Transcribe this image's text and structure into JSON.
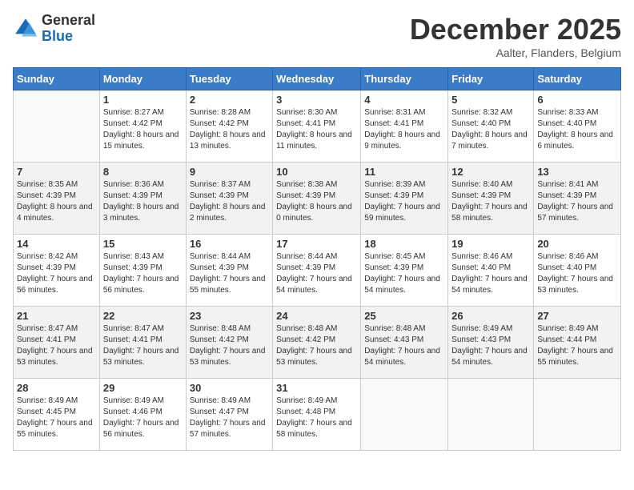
{
  "header": {
    "logo": {
      "general": "General",
      "blue": "Blue"
    },
    "title": "December 2025",
    "subtitle": "Aalter, Flanders, Belgium"
  },
  "weekdays": [
    "Sunday",
    "Monday",
    "Tuesday",
    "Wednesday",
    "Thursday",
    "Friday",
    "Saturday"
  ],
  "weeks": [
    [
      {
        "day": "",
        "empty": true
      },
      {
        "day": "1",
        "sunrise": "8:27 AM",
        "sunset": "4:42 PM",
        "daylight": "8 hours and 15 minutes."
      },
      {
        "day": "2",
        "sunrise": "8:28 AM",
        "sunset": "4:42 PM",
        "daylight": "8 hours and 13 minutes."
      },
      {
        "day": "3",
        "sunrise": "8:30 AM",
        "sunset": "4:41 PM",
        "daylight": "8 hours and 11 minutes."
      },
      {
        "day": "4",
        "sunrise": "8:31 AM",
        "sunset": "4:41 PM",
        "daylight": "8 hours and 9 minutes."
      },
      {
        "day": "5",
        "sunrise": "8:32 AM",
        "sunset": "4:40 PM",
        "daylight": "8 hours and 7 minutes."
      },
      {
        "day": "6",
        "sunrise": "8:33 AM",
        "sunset": "4:40 PM",
        "daylight": "8 hours and 6 minutes."
      }
    ],
    [
      {
        "day": "7",
        "sunrise": "8:35 AM",
        "sunset": "4:39 PM",
        "daylight": "8 hours and 4 minutes."
      },
      {
        "day": "8",
        "sunrise": "8:36 AM",
        "sunset": "4:39 PM",
        "daylight": "8 hours and 3 minutes."
      },
      {
        "day": "9",
        "sunrise": "8:37 AM",
        "sunset": "4:39 PM",
        "daylight": "8 hours and 2 minutes."
      },
      {
        "day": "10",
        "sunrise": "8:38 AM",
        "sunset": "4:39 PM",
        "daylight": "8 hours and 0 minutes."
      },
      {
        "day": "11",
        "sunrise": "8:39 AM",
        "sunset": "4:39 PM",
        "daylight": "7 hours and 59 minutes."
      },
      {
        "day": "12",
        "sunrise": "8:40 AM",
        "sunset": "4:39 PM",
        "daylight": "7 hours and 58 minutes."
      },
      {
        "day": "13",
        "sunrise": "8:41 AM",
        "sunset": "4:39 PM",
        "daylight": "7 hours and 57 minutes."
      }
    ],
    [
      {
        "day": "14",
        "sunrise": "8:42 AM",
        "sunset": "4:39 PM",
        "daylight": "7 hours and 56 minutes."
      },
      {
        "day": "15",
        "sunrise": "8:43 AM",
        "sunset": "4:39 PM",
        "daylight": "7 hours and 56 minutes."
      },
      {
        "day": "16",
        "sunrise": "8:44 AM",
        "sunset": "4:39 PM",
        "daylight": "7 hours and 55 minutes."
      },
      {
        "day": "17",
        "sunrise": "8:44 AM",
        "sunset": "4:39 PM",
        "daylight": "7 hours and 54 minutes."
      },
      {
        "day": "18",
        "sunrise": "8:45 AM",
        "sunset": "4:39 PM",
        "daylight": "7 hours and 54 minutes."
      },
      {
        "day": "19",
        "sunrise": "8:46 AM",
        "sunset": "4:40 PM",
        "daylight": "7 hours and 54 minutes."
      },
      {
        "day": "20",
        "sunrise": "8:46 AM",
        "sunset": "4:40 PM",
        "daylight": "7 hours and 53 minutes."
      }
    ],
    [
      {
        "day": "21",
        "sunrise": "8:47 AM",
        "sunset": "4:41 PM",
        "daylight": "7 hours and 53 minutes."
      },
      {
        "day": "22",
        "sunrise": "8:47 AM",
        "sunset": "4:41 PM",
        "daylight": "7 hours and 53 minutes."
      },
      {
        "day": "23",
        "sunrise": "8:48 AM",
        "sunset": "4:42 PM",
        "daylight": "7 hours and 53 minutes."
      },
      {
        "day": "24",
        "sunrise": "8:48 AM",
        "sunset": "4:42 PM",
        "daylight": "7 hours and 53 minutes."
      },
      {
        "day": "25",
        "sunrise": "8:48 AM",
        "sunset": "4:43 PM",
        "daylight": "7 hours and 54 minutes."
      },
      {
        "day": "26",
        "sunrise": "8:49 AM",
        "sunset": "4:43 PM",
        "daylight": "7 hours and 54 minutes."
      },
      {
        "day": "27",
        "sunrise": "8:49 AM",
        "sunset": "4:44 PM",
        "daylight": "7 hours and 55 minutes."
      }
    ],
    [
      {
        "day": "28",
        "sunrise": "8:49 AM",
        "sunset": "4:45 PM",
        "daylight": "7 hours and 55 minutes."
      },
      {
        "day": "29",
        "sunrise": "8:49 AM",
        "sunset": "4:46 PM",
        "daylight": "7 hours and 56 minutes."
      },
      {
        "day": "30",
        "sunrise": "8:49 AM",
        "sunset": "4:47 PM",
        "daylight": "7 hours and 57 minutes."
      },
      {
        "day": "31",
        "sunrise": "8:49 AM",
        "sunset": "4:48 PM",
        "daylight": "7 hours and 58 minutes."
      },
      {
        "day": "",
        "empty": true
      },
      {
        "day": "",
        "empty": true
      },
      {
        "day": "",
        "empty": true
      }
    ]
  ]
}
